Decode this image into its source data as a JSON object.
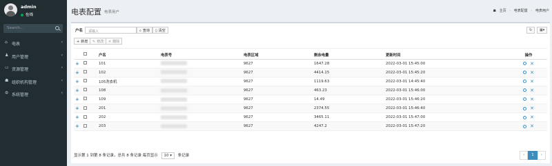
{
  "user": {
    "name": "admin",
    "status": "在线"
  },
  "search": {
    "placeholder": "Search..."
  },
  "menu": [
    {
      "icon": "home-icon",
      "label": "电表"
    },
    {
      "icon": "user-icon",
      "label": "用户管理"
    },
    {
      "icon": "desktop-icon",
      "label": "资源管理"
    },
    {
      "icon": "sitemap-icon",
      "label": "组织机构管理"
    },
    {
      "icon": "gear-icon",
      "label": "系统管理"
    }
  ],
  "header": {
    "title": "电表配置",
    "subtitle": "电表用户",
    "breadcrumb": [
      "主页",
      "电表配置",
      "电表用户"
    ]
  },
  "toolbar": {
    "name_label": "户名",
    "name_placeholder": "请输入",
    "query": "查询",
    "clear": "清空",
    "add": "新增",
    "edit": "修改",
    "delete": "删除"
  },
  "table": {
    "headers": [
      "户名",
      "电表号",
      "电表区域",
      "剩余电量",
      "更新时间",
      "操作"
    ],
    "rows": [
      {
        "name": "101",
        "area": "9627",
        "power": "1647.28",
        "time": "2022-03-01 15:45:00"
      },
      {
        "name": "102",
        "area": "9627",
        "power": "4414.15",
        "time": "2022-03-01 15:45:20"
      },
      {
        "name": "105洗衣机",
        "area": "9627",
        "power": "1119.63",
        "time": "2022-03-01 14:45:40"
      },
      {
        "name": "108",
        "area": "9627",
        "power": "463.23",
        "time": "2022-03-01 15:46:00"
      },
      {
        "name": "109",
        "area": "9627",
        "power": "14.49",
        "time": "2022-03-01 15:46:20"
      },
      {
        "name": "201",
        "area": "9627",
        "power": "2374.55",
        "time": "2022-03-01 15:46:40"
      },
      {
        "name": "202",
        "area": "9627",
        "power": "3465.11",
        "time": "2022-03-01 15:47:00"
      },
      {
        "name": "203",
        "area": "9627",
        "power": "4247.2",
        "time": "2022-03-01 15:47:20"
      }
    ]
  },
  "footer": {
    "summary": "显示第 1 到第 8 条记录，总共 8 条记录 每页显示",
    "page_size": "10",
    "suffix": "条记录"
  },
  "pager": {
    "prev": "‹",
    "current": "1",
    "next": "›"
  }
}
